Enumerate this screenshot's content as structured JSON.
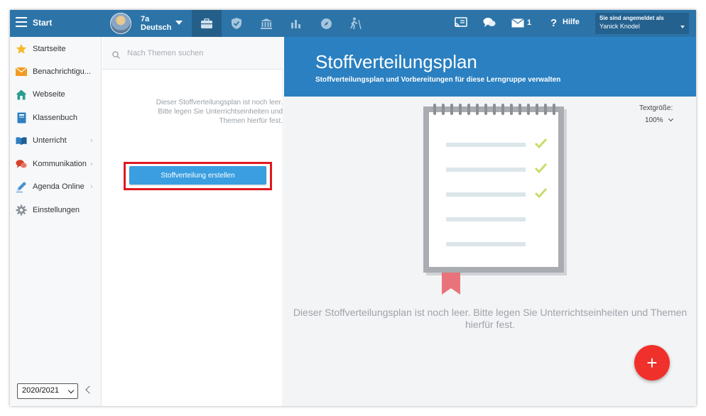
{
  "topbar": {
    "start_label": "Start",
    "class_name": "7a",
    "subject": "Deutsch",
    "mail_count": "1",
    "help_label": "Hilfe",
    "user_line1": "Sie sind angemeldet als",
    "user_name": "Yanick Knodel",
    "nav_icons": [
      "briefcase-icon",
      "shield-icon",
      "bank-icon",
      "bar-chart-icon",
      "compass-icon",
      "hiking-icon"
    ]
  },
  "sidebar": {
    "items": [
      {
        "label": "Startseite",
        "icon": "star-icon",
        "has_submenu": false
      },
      {
        "label": "Benachrichtigu...",
        "icon": "envelope-icon",
        "has_submenu": false
      },
      {
        "label": "Webseite",
        "icon": "house-icon",
        "has_submenu": false
      },
      {
        "label": "Klassenbuch",
        "icon": "book-icon",
        "has_submenu": false
      },
      {
        "label": "Unterricht",
        "icon": "open-book-icon",
        "has_submenu": true
      },
      {
        "label": "Kommunikation",
        "icon": "chat-bubbles-icon",
        "has_submenu": true
      },
      {
        "label": "Agenda Online",
        "icon": "pen-icon",
        "has_submenu": true
      },
      {
        "label": "Einstellungen",
        "icon": "gear-icon",
        "has_submenu": false
      }
    ],
    "school_year": "2020/2021"
  },
  "middle": {
    "search_placeholder": "Nach Themen suchen",
    "empty_text": "Dieser Stoffverteilungsplan ist noch leer. Bitte legen Sie Unterrichtseinheiten und Themen hierfür fest.",
    "create_button": "Stoffverteilung erstellen"
  },
  "main": {
    "title": "Stoffverteilungsplan",
    "subtitle": "Stoffverteilungsplan und Vorbereitungen für diese Lerngruppe verwalten",
    "text_size_label": "Textgröße:",
    "text_size_value": "100%",
    "empty_text": "Dieser Stoffverteilungsplan ist noch leer. Bitte legen Sie Unterrichtseinheiten und Themen hierfür fest.",
    "fab_label": "+"
  },
  "colors": {
    "topbar": "#2c74a8",
    "header": "#2a80c1",
    "button": "#3a9ee0",
    "highlight": "#e0181f",
    "fab": "#f0312b"
  }
}
